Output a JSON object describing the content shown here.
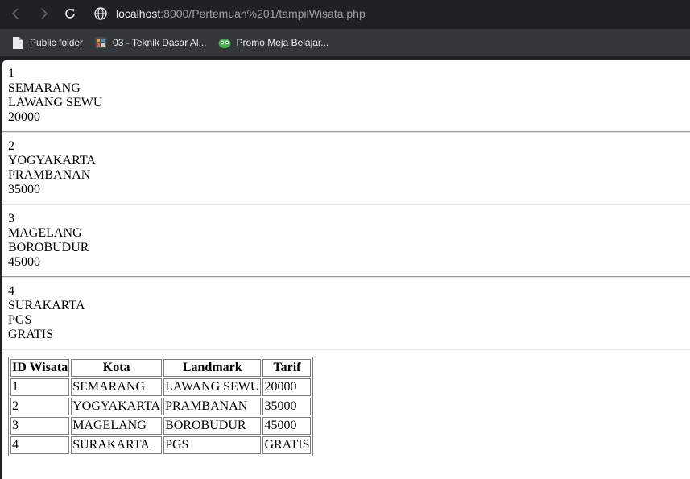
{
  "browser": {
    "url_host": "localhost",
    "url_rest": ":8000/Pertemuan%201/tampilWisata.php",
    "bookmarks": [
      {
        "label": "Public folder",
        "icon": "file-icon"
      },
      {
        "label": "03 - Teknik Dasar Al...",
        "icon": "site-favicon-icon"
      },
      {
        "label": "Promo Meja Belajar...",
        "icon": "shop-favicon-icon"
      }
    ]
  },
  "records": [
    {
      "id": "1",
      "kota": "SEMARANG",
      "landmark": "LAWANG SEWU",
      "tarif": "20000"
    },
    {
      "id": "2",
      "kota": "YOGYAKARTA",
      "landmark": "PRAMBANAN",
      "tarif": "35000"
    },
    {
      "id": "3",
      "kota": "MAGELANG",
      "landmark": "BOROBUDUR",
      "tarif": "45000"
    },
    {
      "id": "4",
      "kota": "SURAKARTA",
      "landmark": "PGS",
      "tarif": "GRATIS"
    }
  ],
  "table": {
    "headers": [
      "ID Wisata",
      "Kota",
      "Landmark",
      "Tarif"
    ],
    "rows": [
      [
        "1",
        "SEMARANG",
        "LAWANG SEWU",
        "20000"
      ],
      [
        "2",
        "YOGYAKARTA",
        "PRAMBANAN",
        "35000"
      ],
      [
        "3",
        "MAGELANG",
        "BOROBUDUR",
        "45000"
      ],
      [
        "4",
        "SURAKARTA",
        "PGS",
        "GRATIS"
      ]
    ]
  }
}
